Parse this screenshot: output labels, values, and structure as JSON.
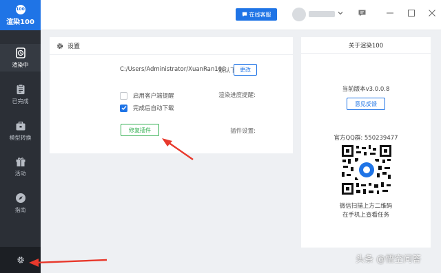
{
  "app": {
    "logo_text": "渲染100",
    "logo_mark": "100"
  },
  "sidebar": {
    "items": [
      {
        "label": "渲染中",
        "icon": "clock-icon"
      },
      {
        "label": "已完成",
        "icon": "clipboard-icon"
      },
      {
        "label": "模型转换",
        "icon": "briefcase-icon"
      },
      {
        "label": "活动",
        "icon": "gift-icon"
      },
      {
        "label": "指南",
        "icon": "compass-icon"
      }
    ],
    "settings_icon": "gear-icon"
  },
  "topbar": {
    "service_label": "在线客服"
  },
  "settings": {
    "title": "设置",
    "download_path_label": "默认下载路径:",
    "download_path_value": "C:/Users/Administrator/XuanRan100",
    "change_button": "更改",
    "progress_label": "渲染进度提醒:",
    "option_client_notify": "启用客户端提醒",
    "option_client_notify_checked": false,
    "option_auto_download": "完成后自动下载",
    "option_auto_download_checked": true,
    "plugin_label": "插件设置:",
    "repair_plugin_button": "修复插件"
  },
  "about": {
    "title": "关于渲染100",
    "version": "当前版本v3.0.0.8",
    "feedback_button": "意见反馈",
    "qq_group": "官方QQ群: 550239477",
    "scan_line1": "微信扫描上方二维码",
    "scan_line2": "在手机上查看任务"
  },
  "watermark": "头条 @悟空问答",
  "colors": {
    "accent": "#1f74e6",
    "sidebar": "#2b2f36",
    "green": "#2fae4e",
    "arrow": "#e8392c"
  }
}
